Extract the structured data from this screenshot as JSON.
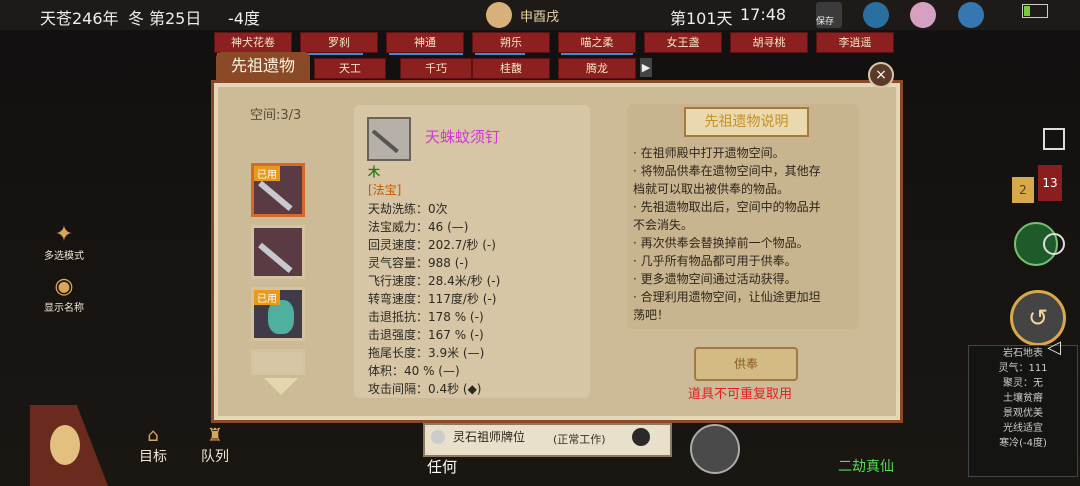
{
  "status": {
    "era": "天苍246年",
    "season": "冬",
    "day": "第25日",
    "temperature": "-4度",
    "calendar": "申酉戌",
    "day_counter": "第101天",
    "time": "17:48",
    "save_label": "保存"
  },
  "tabs_row1": [
    "神犬花卷",
    "罗刹",
    "神通",
    "朔乐",
    "喵之柔",
    "女王盏",
    "胡寻桃",
    "李逍遥"
  ],
  "tabs_row2": [
    "天工",
    "千巧",
    "桂馥",
    "腾龙"
  ],
  "dialog": {
    "title": "先祖遗物",
    "space": "空间:3/3",
    "slot_badges": [
      "已用",
      "已用"
    ],
    "item": {
      "name": "天蛛蚊须钉",
      "element": "木",
      "category": "[法宝]",
      "stats": [
        "天劫洗练：0次",
        "法宝威力：46 (—)",
        "回灵速度：202.7/秒 (-)",
        "灵气容量：988 (-)",
        "飞行速度：28.4米/秒 (-)",
        "转弯速度：117度/秒 (-)",
        "击退抵抗：178 % (-)",
        "击退强度：167 % (-)",
        "拖尾长度：3.9米 (—)",
        "体积：40 % (—)",
        "攻击间隔：0.4秒 (◆)"
      ]
    },
    "desc_title": "先祖遗物说明",
    "desc_lines": [
      "· 在祖师殿中打开遗物空间。",
      "· 将物品供奉在遗物空间中，其他存",
      "  档就可以取出被供奉的物品。",
      "· 先祖遗物取出后，空间中的物品并",
      "  不会消失。",
      "· 再次供奉会替换掉前一个物品。",
      "· 几乎所有物品都可用于供奉。",
      "· 更多遗物空间通过活动获得。",
      "· 合理利用遗物空间，让仙途更加坦",
      "  荡吧！"
    ],
    "offer_button": "供奉",
    "warning": "道具不可重复取用"
  },
  "side": {
    "multi_select": "多选模式",
    "show_names": "显示名称",
    "target": "目标",
    "queue": "队列",
    "second_stage": "二劫真仙",
    "notification_count": "13",
    "badge_small": "2"
  },
  "info_panel": [
    "岩石地表",
    "灵气：111",
    "聚灵：无",
    "土壤贫瘠",
    "景观优美",
    "光线适宜",
    "寒冷(-4度)"
  ],
  "bottom": {
    "ancestor_title": "灵石祖师牌位",
    "status": "(正常工作)",
    "any_label": "任何"
  },
  "colors": {
    "accent_brown": "#8a4a28",
    "panel": "#cdbb98",
    "warning": "#e02020",
    "item_name": "#d03ad0"
  }
}
